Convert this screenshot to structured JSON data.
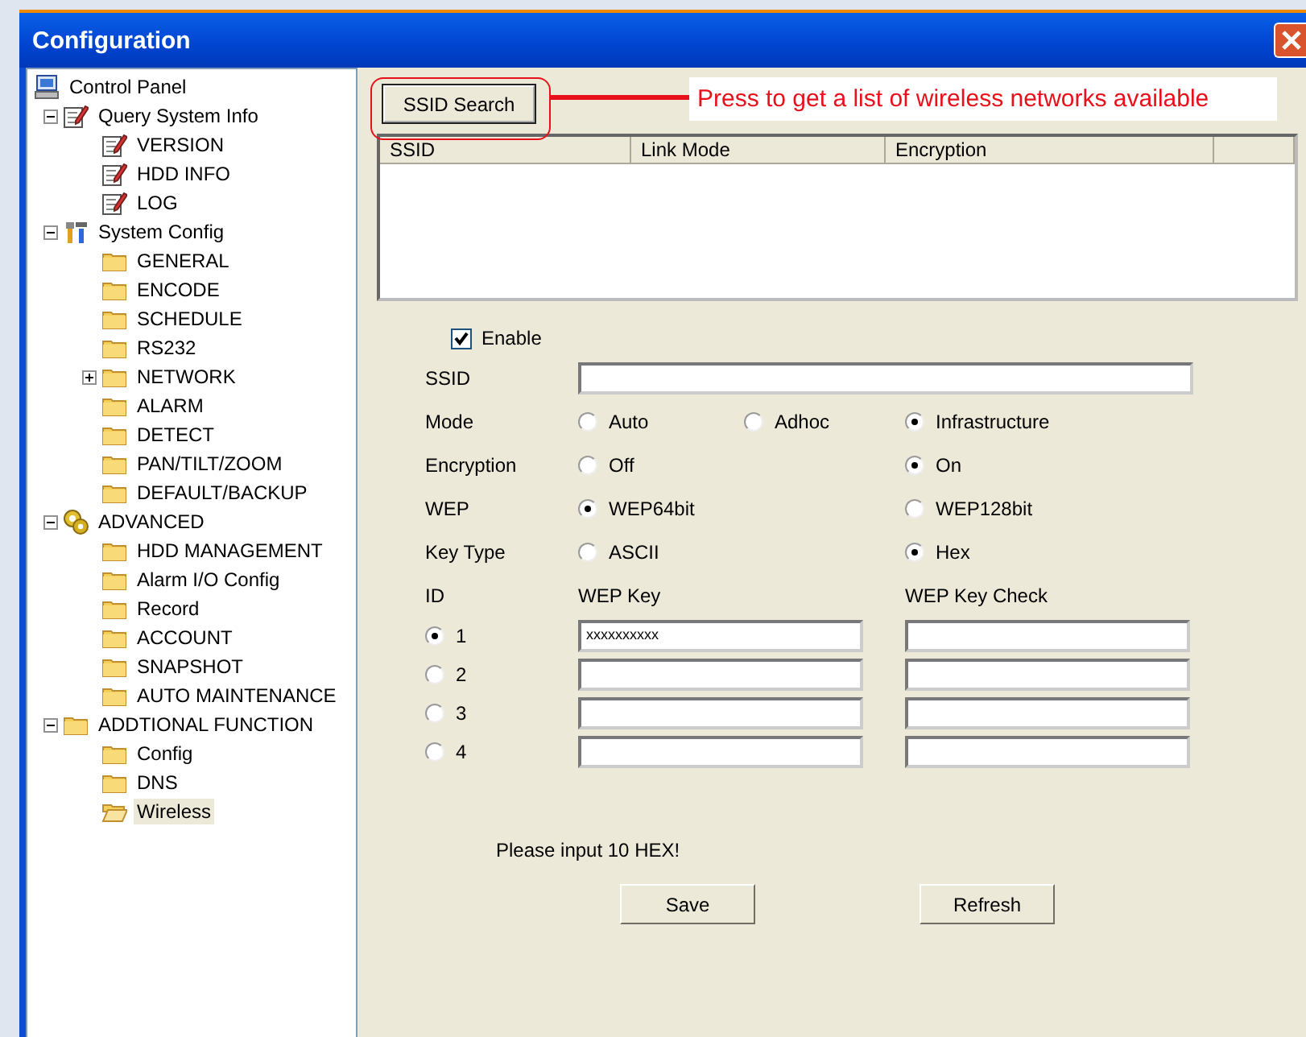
{
  "window": {
    "title": "Configuration"
  },
  "tree": [
    {
      "label": "Control Panel",
      "kind": "computer",
      "selected": false,
      "children": [
        {
          "label": "Query System Info",
          "kind": "note",
          "expanded": true,
          "selected": false,
          "children": [
            {
              "label": "VERSION",
              "kind": "note",
              "selected": false
            },
            {
              "label": "HDD INFO",
              "kind": "note",
              "selected": false
            },
            {
              "label": "LOG",
              "kind": "note",
              "selected": false
            }
          ]
        },
        {
          "label": "System Config",
          "kind": "tools",
          "expanded": true,
          "selected": false,
          "children": [
            {
              "label": "GENERAL",
              "kind": "folder",
              "selected": false
            },
            {
              "label": "ENCODE",
              "kind": "folder",
              "selected": false
            },
            {
              "label": "SCHEDULE",
              "kind": "folder",
              "selected": false
            },
            {
              "label": "RS232",
              "kind": "folder",
              "selected": false
            },
            {
              "label": "NETWORK",
              "kind": "folder",
              "expanded": false,
              "selected": false
            },
            {
              "label": "ALARM",
              "kind": "folder",
              "selected": false
            },
            {
              "label": "DETECT",
              "kind": "folder",
              "selected": false
            },
            {
              "label": "PAN/TILT/ZOOM",
              "kind": "folder",
              "selected": false
            },
            {
              "label": "DEFAULT/BACKUP",
              "kind": "folder",
              "selected": false
            }
          ]
        },
        {
          "label": "ADVANCED",
          "kind": "gears",
          "expanded": true,
          "selected": false,
          "children": [
            {
              "label": "HDD MANAGEMENT",
              "kind": "folder",
              "selected": false
            },
            {
              "label": "Alarm I/O Config",
              "kind": "folder",
              "selected": false
            },
            {
              "label": "Record",
              "kind": "folder",
              "selected": false
            },
            {
              "label": "ACCOUNT",
              "kind": "folder",
              "selected": false
            },
            {
              "label": "SNAPSHOT",
              "kind": "folder",
              "selected": false
            },
            {
              "label": "AUTO MAINTENANCE",
              "kind": "folder",
              "selected": false
            }
          ]
        },
        {
          "label": "ADDTIONAL FUNCTION",
          "kind": "folder",
          "expanded": true,
          "selected": false,
          "children": [
            {
              "label": "Config",
              "kind": "folder",
              "selected": false
            },
            {
              "label": "DNS",
              "kind": "folder",
              "selected": false
            },
            {
              "label": "Wireless",
              "kind": "open-folder",
              "selected": true
            }
          ]
        }
      ]
    }
  ],
  "search_button": {
    "label": "SSID Search"
  },
  "annotation": {
    "text": "Press to get a list of wireless networks available"
  },
  "network_list": {
    "columns": [
      "SSID",
      "Link Mode",
      "Encryption"
    ]
  },
  "enable": {
    "label": "Enable",
    "checked": true
  },
  "ssid": {
    "label": "SSID"
  },
  "options": [
    {
      "label": "Mode",
      "choices": [
        {
          "label": "Auto",
          "selected": false
        },
        {
          "label": "Adhoc",
          "selected": false
        },
        {
          "label": "Infrastructure",
          "selected": true
        }
      ]
    },
    {
      "label": "Encryption",
      "choices": [
        {
          "label": "Off",
          "selected": false
        },
        {
          "label": "On",
          "selected": true
        }
      ]
    },
    {
      "label": "WEP",
      "choices": [
        {
          "label": "WEP64bit",
          "selected": true
        },
        {
          "label": "WEP128bit",
          "selected": false
        }
      ]
    },
    {
      "label": "Key Type",
      "choices": [
        {
          "label": "ASCII",
          "selected": false
        },
        {
          "label": "Hex",
          "selected": true
        }
      ]
    }
  ],
  "keys": {
    "id_header": "ID",
    "key_header": "WEP Key",
    "check_header": "WEP Key Check",
    "rows": [
      {
        "id": "1",
        "selected": true,
        "key": "xxxxxxxxxx"
      },
      {
        "id": "2",
        "selected": false
      },
      {
        "id": "3",
        "selected": false
      },
      {
        "id": "4",
        "selected": false
      }
    ]
  },
  "message": "Please input 10 HEX!",
  "buttons": [
    {
      "label": "Save"
    },
    {
      "label": "Refresh"
    }
  ]
}
